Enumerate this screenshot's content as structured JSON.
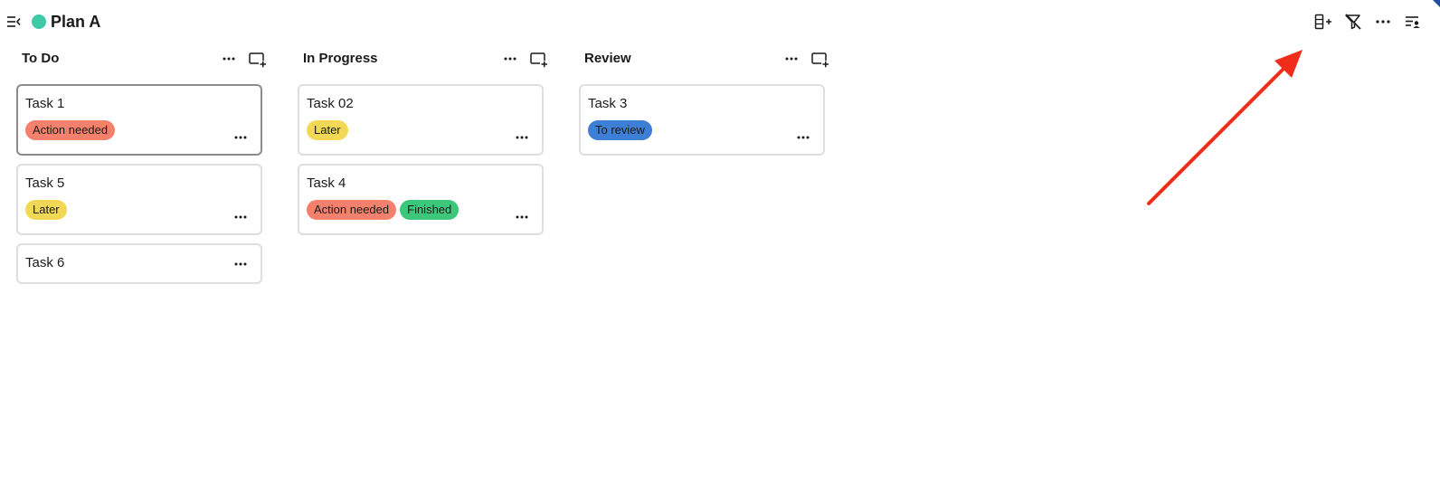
{
  "header": {
    "plan_title": "Plan A",
    "plan_color": "#3ec9a7",
    "toolbar": [
      {
        "name": "add-column-icon"
      },
      {
        "name": "clear-filter-icon"
      },
      {
        "name": "more-icon"
      },
      {
        "name": "view-settings-icon"
      }
    ]
  },
  "board": {
    "columns": [
      {
        "title": "To Do",
        "cards": [
          {
            "title": "Task 1",
            "selected": true,
            "tags": [
              {
                "label": "Action needed",
                "color": "#f5806b"
              }
            ]
          },
          {
            "title": "Task 5",
            "tags": [
              {
                "label": "Later",
                "color": "#f2d955"
              }
            ]
          },
          {
            "title": "Task 6",
            "tags": []
          }
        ]
      },
      {
        "title": "In Progress",
        "cards": [
          {
            "title": "Task 02",
            "tags": [
              {
                "label": "Later",
                "color": "#f2d955"
              }
            ]
          },
          {
            "title": "Task 4",
            "tags": [
              {
                "label": "Action needed",
                "color": "#f5806b"
              },
              {
                "label": "Finished",
                "color": "#3dc77a"
              }
            ]
          }
        ]
      },
      {
        "title": "Review",
        "cards": [
          {
            "title": "Task 3",
            "tags": [
              {
                "label": "To review",
                "color": "#3d7fd6"
              }
            ]
          }
        ]
      }
    ]
  },
  "annotation": {
    "arrow_color": "#f02d1a"
  }
}
